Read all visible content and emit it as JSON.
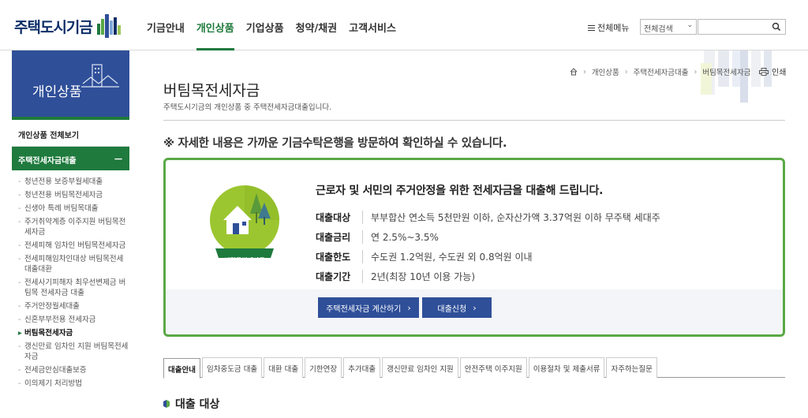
{
  "header": {
    "logo_text": "주택도시기금",
    "gnb": [
      "기금안내",
      "개인상품",
      "기업상품",
      "청약/채권",
      "고객서비스"
    ],
    "active_gnb": 1,
    "all_menu": "전체메뉴",
    "search_select": "전체검색",
    "search_placeholder": ""
  },
  "sidebar": {
    "hero_title": "개인상품",
    "all_view": "개인상품 전체보기",
    "category": "주택전세자금대출",
    "category_toggle": "－",
    "items": [
      {
        "label": "청년전용 보증부월세대출",
        "active": false
      },
      {
        "label": "청년전용 버팀목전세자금",
        "active": false
      },
      {
        "label": "신생아 특례 버팀목대출",
        "active": false
      },
      {
        "label": "주거취약계층 이주지원 버팀목전세자금",
        "active": false
      },
      {
        "label": "전세피해 임차인 버팀목전세자금",
        "active": false
      },
      {
        "label": "전세피해임차인대상 버팀목전세대출대환",
        "active": false
      },
      {
        "label": "전세사기피해자 최우선변제금 버팀목 전세자금 대출",
        "active": false
      },
      {
        "label": "주거안정월세대출",
        "active": false
      },
      {
        "label": "신혼부부전용 전세자금",
        "active": false
      },
      {
        "label": "버팀목전세자금",
        "active": true
      },
      {
        "label": "갱신만료 임차인 지원 버팀목전세자금",
        "active": false
      },
      {
        "label": "전세금안심대출보증",
        "active": false
      },
      {
        "label": "이의제기 처리방법",
        "active": false
      }
    ]
  },
  "breadcrumb": [
    "개인상품",
    "주택전세자금대출",
    "버팀목전세자금"
  ],
  "print_label": "인쇄",
  "page": {
    "title": "버팀목전세자금",
    "subtitle": "주택도시기금의 개인상품 중 주택전세자금대출입니다.",
    "notice": "※ 자세한 내용은 가까운 기금수탁은행을 방문하여 확인하실 수 있습니다."
  },
  "product_box": {
    "lead": "근로자 및 서민의 주거안정을 위한 전세자금을 대출해 드립니다.",
    "emblem_label": "버팀목전세자금",
    "rows": [
      {
        "label": "대출대상",
        "value": "부부합산 연소득 5천만원 이하, 순자산가액 3.37억원 이하 무주택 세대주"
      },
      {
        "label": "대출금리",
        "value": "연 2.5%~3.5%"
      },
      {
        "label": "대출한도",
        "value": "수도권 1.2억원, 수도권 외 0.8억원 이내"
      },
      {
        "label": "대출기간",
        "value": "2년(최장 10년 이용 가능)"
      }
    ],
    "buttons": [
      "주택전세자금 계산하기",
      "대출신청"
    ]
  },
  "tabs": [
    "대출안내",
    "임차중도금 대출",
    "대환 대출",
    "기한연장",
    "추가대출",
    "갱신만료 임차인 지원",
    "안전주택 이주지원",
    "이용절차 및 제출서류",
    "자주하는질문"
  ],
  "active_tab": 0,
  "section_title": "대출 대상",
  "colors": {
    "green": "#1f7a3d",
    "navy": "#2f4f99",
    "box_border": "#5aa845"
  }
}
